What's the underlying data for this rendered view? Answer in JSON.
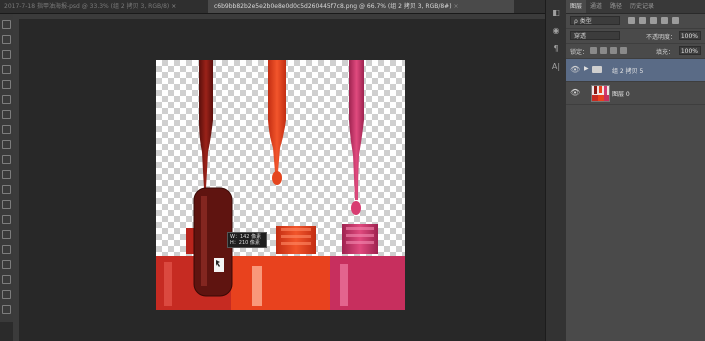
{
  "tabs": {
    "inactive": "2017-7-18 指甲油海报-psd @ 33.3% (组 2 拷贝 3, RGB/8)",
    "active": "c6b9bb82b2e5e2b0e8e0d0c5d260445f7c8.png @ 66.7% (组 2 拷贝 3, RGB/8#)",
    "close_glyph": "×"
  },
  "canvas": {
    "tooltip_line1": "W：142 像素",
    "tooltip_line2": "H：210 像素"
  },
  "dock": {
    "icons": [
      "layers-icon",
      "adjust-icon",
      "paragraph-icon",
      "character-icon"
    ],
    "glyphs": [
      "◧",
      "◉",
      "¶",
      "A|"
    ]
  },
  "layers_panel": {
    "tabs": [
      "图层",
      "通道",
      "路径",
      "历史记录"
    ],
    "filter_kind": "ρ 类型",
    "blend_mode": "穿透",
    "opacity_label": "不透明度：",
    "opacity_value": "100%",
    "lock_label": "锁定：",
    "fill_label": "填充：",
    "fill_value": "100%",
    "layers": [
      {
        "name": "组 2 拷贝 5",
        "type": "group",
        "selected": true
      },
      {
        "name": "图层 0",
        "type": "pixel",
        "selected": false
      }
    ]
  },
  "colors": {
    "selected_layer": "#5a6b86",
    "polish_dark_red": "#7a1a14",
    "polish_orange": "#e8421e",
    "polish_pink": "#d0396b"
  }
}
